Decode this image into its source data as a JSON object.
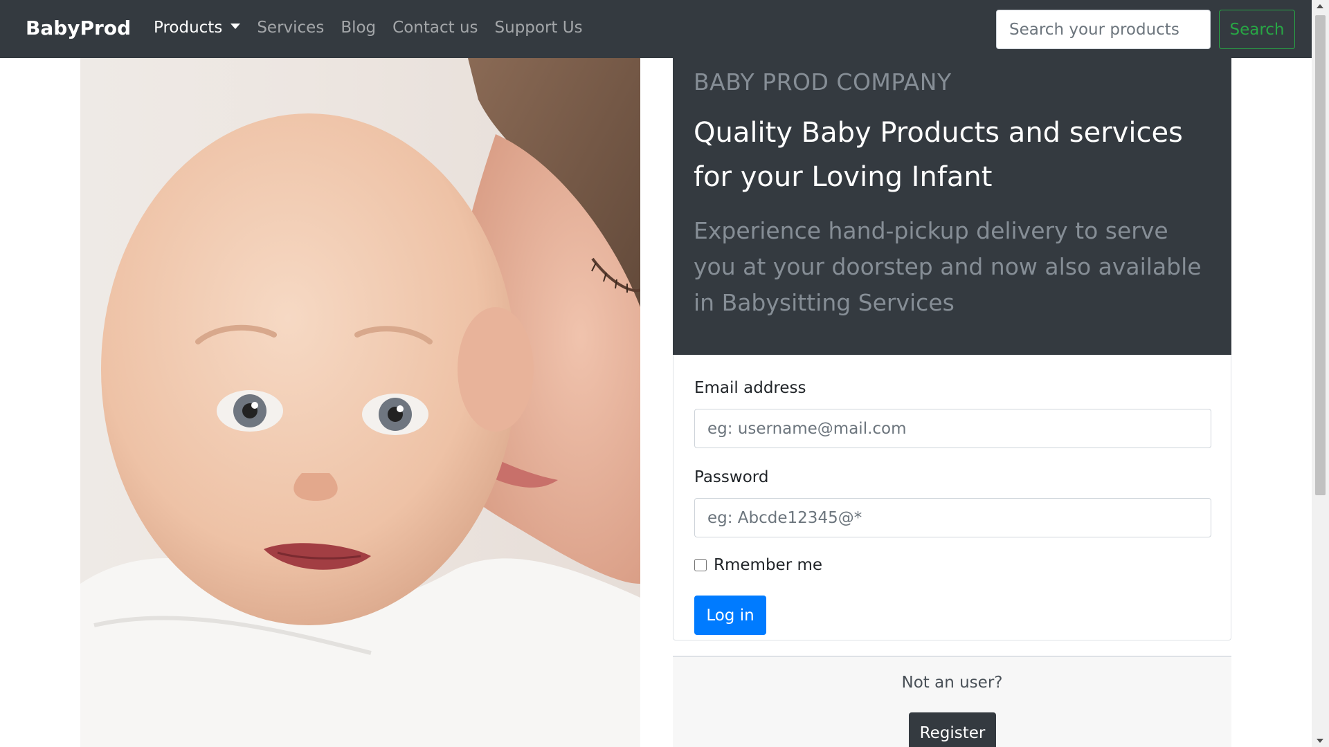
{
  "navbar": {
    "brand": "BabyProd",
    "links": [
      {
        "label": "Products"
      },
      {
        "label": "Services"
      },
      {
        "label": "Blog"
      },
      {
        "label": "Contact us"
      },
      {
        "label": "Support Us"
      }
    ],
    "search_placeholder": "Search your products",
    "search_button": "Search"
  },
  "hero": {
    "image": "baby-with-mother-photo"
  },
  "jumbotron": {
    "company": "BABY PROD COMPANY",
    "headline": "Quality Baby Products and services for your Loving Infant",
    "lead": "Experience hand-pickup delivery to serve you at your doorstep and now also available in Babysitting Services"
  },
  "login": {
    "email_label": "Email address",
    "email_placeholder": "eg: username@mail.com",
    "password_label": "Password",
    "password_placeholder": "eg: Abcde12345@*",
    "remember_label": "Rmember me",
    "remember_checked": false,
    "login_button": "Log in"
  },
  "register": {
    "prompt": "Not an user?",
    "button": "Register"
  },
  "colors": {
    "navbar_bg": "#343a40",
    "primary": "#007bff",
    "success": "#28a745",
    "muted": "#868e96"
  }
}
